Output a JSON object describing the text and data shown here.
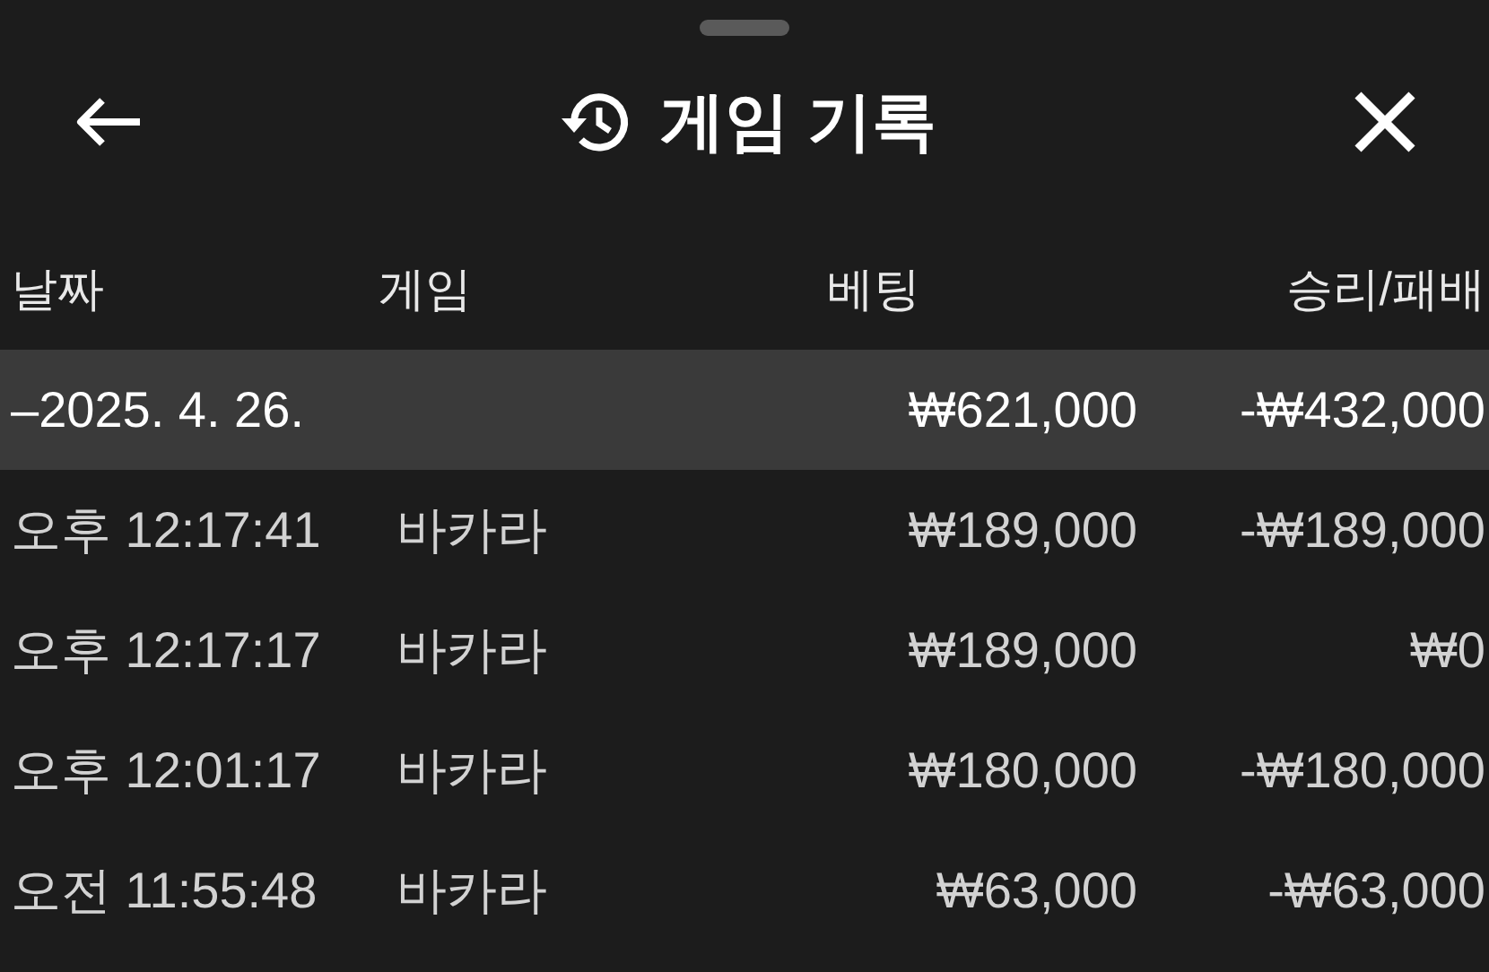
{
  "header": {
    "title": "게임 기록"
  },
  "table": {
    "columns": [
      "날짜",
      "게임",
      "베팅",
      "승리/패배"
    ],
    "groups": [
      {
        "date": "–2025. 4. 26.",
        "bet": "₩621,000",
        "result": "-₩432,000",
        "rows": [
          {
            "time": "오후 12:17:41",
            "game": "바카라",
            "bet": "₩189,000",
            "result": "-₩189,000"
          },
          {
            "time": "오후 12:17:17",
            "game": "바카라",
            "bet": "₩189,000",
            "result": "₩0"
          },
          {
            "time": "오후 12:01:17",
            "game": "바카라",
            "bet": "₩180,000",
            "result": "-₩180,000"
          },
          {
            "time": "오전 11:55:48",
            "game": "바카라",
            "bet": "₩63,000",
            "result": "-₩63,000"
          }
        ]
      }
    ]
  }
}
